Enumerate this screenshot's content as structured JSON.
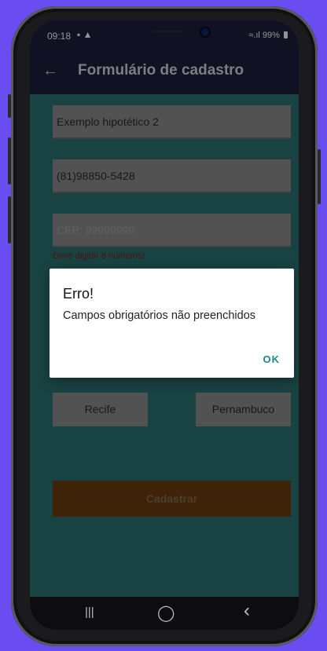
{
  "status_bar": {
    "time": "09:18",
    "left_icons": "▪ ▲",
    "right_text": "99%"
  },
  "app_bar": {
    "back_icon": "←",
    "title": "Formulário de cadastro"
  },
  "form": {
    "name_value": "Exemplo hipotético 2",
    "phone_value": "(81)98850-5428",
    "cep_placeholder": "CEP: 99999999",
    "cep_error": "Deve digitar 8 números!",
    "city_value": "Recife",
    "state_value": "Pernambuco",
    "submit_label": "Cadastrar"
  },
  "dialog": {
    "title": "Erro!",
    "message": "Campos obrigatórios não preenchidos",
    "ok_label": "OK"
  },
  "nav_bar": {
    "recents_icon": "|||",
    "home_icon": "◯",
    "back_icon": "‹"
  },
  "colors": {
    "background": "#6a4df0",
    "app_bar": "#1e1e3e",
    "content": "#2b7373",
    "submit": "#6b3d0f",
    "error": "#8b1a1a",
    "ok_accent": "#1a8a8a"
  }
}
